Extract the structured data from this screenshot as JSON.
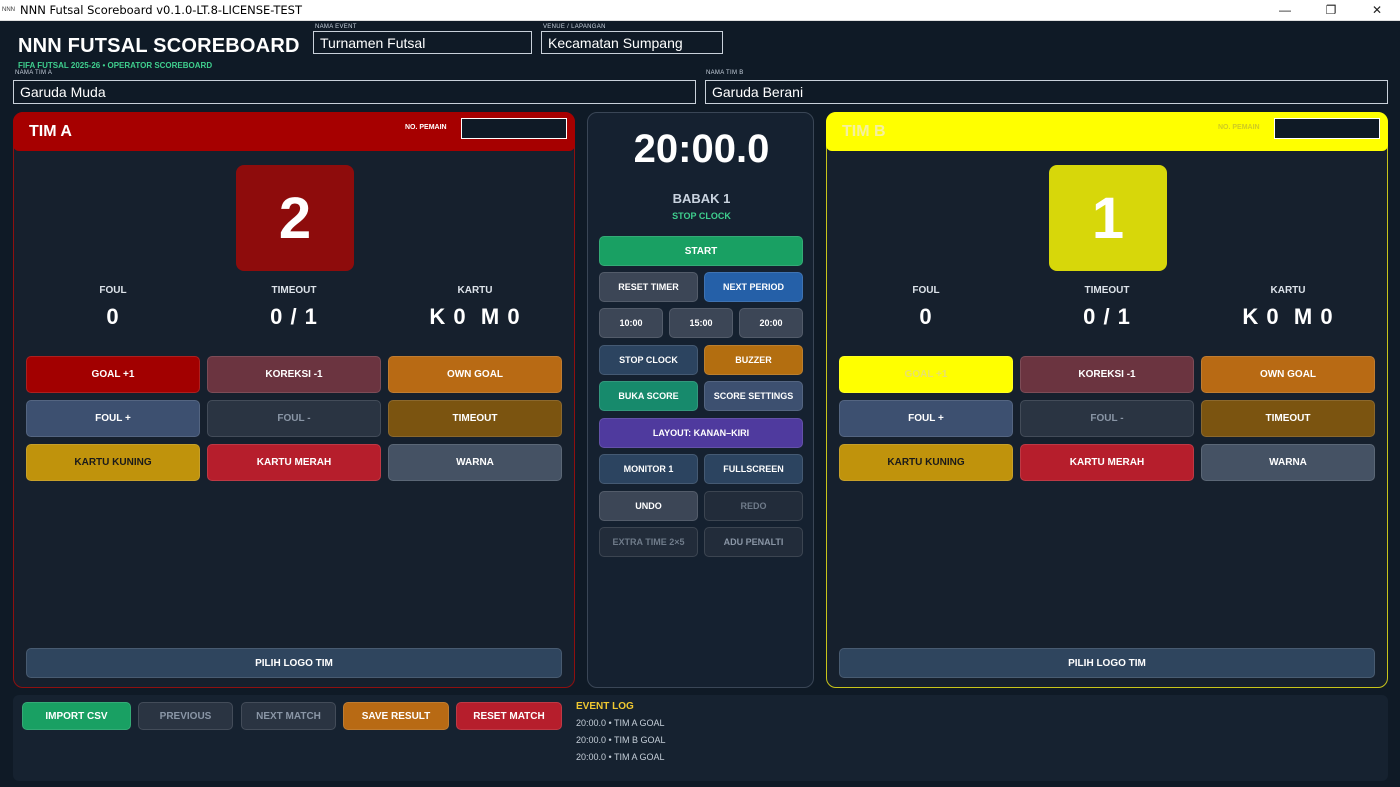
{
  "window": {
    "title": "NNN Futsal Scoreboard v0.1.0-LT.8-LICENSE-TEST",
    "icon_text": "NNN",
    "minimize": "—",
    "restore": "❐",
    "close": "✕"
  },
  "header": {
    "brand": "NNN FUTSAL SCOREBOARD",
    "subtitle": "FIFA FUTSAL 2025-26 • OPERATOR SCOREBOARD",
    "event_label": "NAMA EVENT",
    "event_value": "Turnamen Futsal",
    "venue_label": "VENUE / LAPANGAN",
    "venue_value": "Kecamatan Sumpang",
    "team_a_label": "NAMA TIM A",
    "team_a_value": "Garuda Muda",
    "team_b_label": "NAMA TIM B",
    "team_b_value": "Garuda Berani"
  },
  "team_a": {
    "name": "TIM A",
    "player_no_label": "NO. PEMAIN",
    "player_no_value": "",
    "score": "2",
    "foul_label": "FOUL",
    "foul_value": "0",
    "timeout_label": "TIMEOUT",
    "timeout_value": "0 / 1",
    "card_label": "KARTU",
    "card_value": "K 0  M 0",
    "buttons": {
      "goal": "GOAL +1",
      "koreksi": "KOREKSI -1",
      "own_goal": "OWN GOAL",
      "foul_plus": "FOUL +",
      "foul_minus": "FOUL -",
      "timeout": "TIMEOUT",
      "yellow_card": "KARTU KUNING",
      "red_card": "KARTU MERAH",
      "color": "WARNA",
      "logo": "PILIH LOGO TIM"
    },
    "accent": "#a60000"
  },
  "team_b": {
    "name": "TIM B",
    "player_no_label": "NO. PEMAIN",
    "player_no_value": "",
    "score": "1",
    "foul_label": "FOUL",
    "foul_value": "0",
    "timeout_label": "TIMEOUT",
    "timeout_value": "0 / 1",
    "card_label": "KARTU",
    "card_value": "K 0  M 0",
    "buttons": {
      "goal": "GOAL +1",
      "koreksi": "KOREKSI -1",
      "own_goal": "OWN GOAL",
      "foul_plus": "FOUL +",
      "foul_minus": "FOUL -",
      "timeout": "TIMEOUT",
      "yellow_card": "KARTU KUNING",
      "red_card": "KARTU MERAH",
      "color": "WARNA",
      "logo": "PILIH LOGO TIM"
    },
    "accent": "#ffff00"
  },
  "center": {
    "clock": "20:00.0",
    "period": "BABAK 1",
    "clock_state": "STOP CLOCK",
    "start": "START",
    "reset_timer": "RESET TIMER",
    "next_period": "NEXT PERIOD",
    "preset_10": "10:00",
    "preset_15": "15:00",
    "preset_20": "20:00",
    "stop_clock": "STOP CLOCK",
    "buzzer": "BUZZER",
    "open_score": "BUKA SCORE",
    "score_settings": "SCORE SETTINGS",
    "layout": "LAYOUT: KANAN–KIRI",
    "monitor": "MONITOR 1",
    "fullscreen": "FULLSCREEN",
    "undo": "UNDO",
    "redo": "REDO",
    "extra_time": "EXTRA TIME 2×5",
    "penalty": "ADU PENALTI"
  },
  "footer": {
    "import_csv": "IMPORT CSV",
    "previous": "PREVIOUS",
    "next_match": "NEXT MATCH",
    "save_result": "SAVE RESULT",
    "reset_match": "RESET MATCH",
    "event_log_title": "EVENT LOG",
    "event_log": [
      "20:00.0 • TIM A GOAL",
      "20:00.0 • TIM B GOAL",
      "20:00.0 • TIM A GOAL"
    ]
  }
}
